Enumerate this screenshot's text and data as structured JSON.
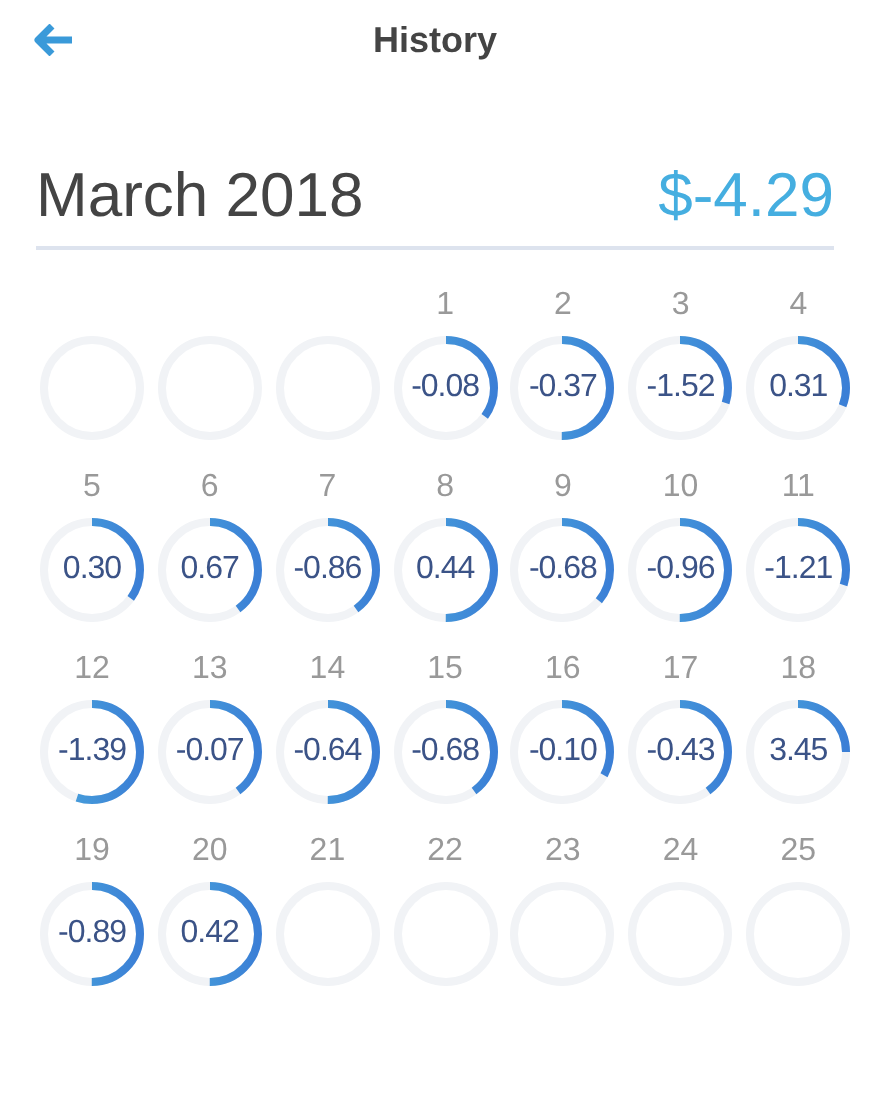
{
  "header": {
    "back_icon": true,
    "title": "History"
  },
  "summary": {
    "month": "March 2018",
    "total": "$-4.29"
  },
  "days": [
    {
      "kind": "blank"
    },
    {
      "kind": "blank"
    },
    {
      "kind": "blank"
    },
    {
      "kind": "day",
      "label": "1",
      "value": "-0.08",
      "level": 0.35
    },
    {
      "kind": "day",
      "label": "2",
      "value": "-0.37",
      "level": 0.5
    },
    {
      "kind": "day",
      "label": "3",
      "value": "-1.52",
      "level": 0.3
    },
    {
      "kind": "day",
      "label": "4",
      "value": "0.31",
      "level": 0.31
    },
    {
      "kind": "day",
      "label": "5",
      "value": "0.30",
      "level": 0.35
    },
    {
      "kind": "day",
      "label": "6",
      "value": "0.67",
      "level": 0.4
    },
    {
      "kind": "day",
      "label": "7",
      "value": "-0.86",
      "level": 0.4
    },
    {
      "kind": "day",
      "label": "8",
      "value": "0.44",
      "level": 0.5
    },
    {
      "kind": "day",
      "label": "9",
      "value": "-0.68",
      "level": 0.36
    },
    {
      "kind": "day",
      "label": "10",
      "value": "-0.96",
      "level": 0.5
    },
    {
      "kind": "day",
      "label": "11",
      "value": "-1.21",
      "level": 0.3
    },
    {
      "kind": "day",
      "label": "12",
      "value": "-1.39",
      "level": 0.55
    },
    {
      "kind": "day",
      "label": "13",
      "value": "-0.07",
      "level": 0.4
    },
    {
      "kind": "day",
      "label": "14",
      "value": "-0.64",
      "level": 0.5
    },
    {
      "kind": "day",
      "label": "15",
      "value": "-0.68",
      "level": 0.4
    },
    {
      "kind": "day",
      "label": "16",
      "value": "-0.10",
      "level": 0.33
    },
    {
      "kind": "day",
      "label": "17",
      "value": "-0.43",
      "level": 0.4
    },
    {
      "kind": "day",
      "label": "18",
      "value": "3.45",
      "level": 0.25
    },
    {
      "kind": "day",
      "label": "19",
      "value": "-0.89",
      "level": 0.5
    },
    {
      "kind": "day",
      "label": "20",
      "value": "0.42",
      "level": 0.5
    },
    {
      "kind": "day",
      "label": "21"
    },
    {
      "kind": "day",
      "label": "22"
    },
    {
      "kind": "day",
      "label": "23"
    },
    {
      "kind": "day",
      "label": "24"
    },
    {
      "kind": "day",
      "label": "25"
    }
  ]
}
